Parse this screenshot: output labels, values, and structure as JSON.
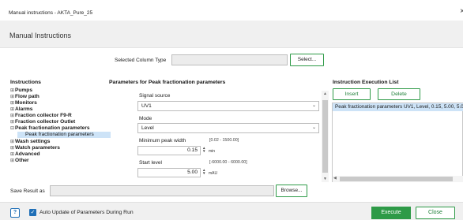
{
  "window": {
    "title": "Manual instructions - AKTA_Pure_25",
    "close_glyph": "×"
  },
  "header": {
    "title": "Manual Instructions"
  },
  "column_type": {
    "label": "Selected Column Type",
    "value": "",
    "select_label": "Select..."
  },
  "instructions": {
    "heading": "Instructions",
    "items": [
      {
        "label": "Pumps",
        "expanded": false
      },
      {
        "label": "Flow path",
        "expanded": false
      },
      {
        "label": "Monitors",
        "expanded": false
      },
      {
        "label": "Alarms",
        "expanded": false
      },
      {
        "label": "Fraction collector F9-R",
        "expanded": false
      },
      {
        "label": "Fraction collector Outlet",
        "expanded": false
      },
      {
        "label": "Peak fractionation parameters",
        "expanded": true
      },
      {
        "label": "Wash settings",
        "expanded": false
      },
      {
        "label": "Watch parameters",
        "expanded": false
      },
      {
        "label": "Advanced",
        "expanded": false
      },
      {
        "label": "Other",
        "expanded": false
      }
    ],
    "selected_child": "Peak fractionation parameters"
  },
  "parameters": {
    "heading": "Parameters for Peak fractionation parameters",
    "signal_source": {
      "label": "Signal source",
      "value": "UV1"
    },
    "mode": {
      "label": "Mode",
      "value": "Level"
    },
    "min_peak_width": {
      "label": "Minimum peak width",
      "range": "[0.02 - 1500.00]",
      "value": "0.15",
      "unit": "min"
    },
    "start_level": {
      "label": "Start level",
      "range": "[-6000.00 - 6000.00]",
      "value": "5.00",
      "unit": "mAU"
    }
  },
  "execution_list": {
    "heading": "Instruction Execution List",
    "insert_label": "Insert",
    "delete_label": "Delete",
    "items": [
      "Peak fractionation parameters UV1, Level, 0.15, 5.00, 5.00"
    ]
  },
  "save_result": {
    "label": "Save Result as",
    "value": "",
    "browse_label": "Browse..."
  },
  "footer": {
    "help_glyph": "?",
    "auto_update_label": "Auto Update of Parameters During Run",
    "auto_update_checked": true,
    "execute_label": "Execute",
    "close_label": "Close"
  },
  "colors": {
    "accent_green": "#2e9a47",
    "selection_blue": "#cde3f7",
    "checkbox_blue": "#1f6fb7"
  }
}
